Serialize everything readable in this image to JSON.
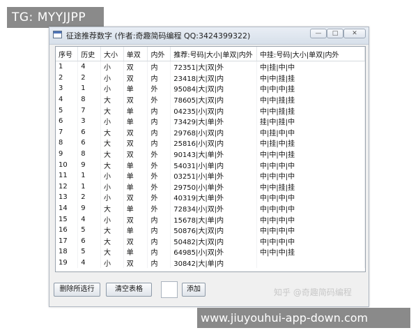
{
  "overlay": {
    "tg_label": "TG: MYYJJPP",
    "url_banner": "www.jiuyouhui-app-down.com",
    "zhihu_watermark": "知乎 @奇趣简码编程"
  },
  "window": {
    "title": "征途推荐数字 (作者:奇趣简码编程 QQ:3424399322)",
    "minimize_glyph": "—",
    "maximize_glyph": "□",
    "close_glyph": "✕"
  },
  "table": {
    "columns": [
      "序号",
      "历史",
      "大小",
      "单双",
      "内外",
      "推荐:号码|大小|单双|内外",
      "中挂:号码|大小|单双|内外"
    ],
    "rows": [
      [
        "1",
        "4",
        "小",
        "双",
        "内",
        "72351|大|双|外",
        "中|挂|中|中"
      ],
      [
        "2",
        "2",
        "小",
        "双",
        "内",
        "23418|大|双|内",
        "中|中|挂|挂"
      ],
      [
        "3",
        "1",
        "小",
        "单",
        "外",
        "95084|大|双|内",
        "中|中|中|挂"
      ],
      [
        "4",
        "8",
        "大",
        "双",
        "外",
        "78605|大|双|内",
        "中|中|挂|挂"
      ],
      [
        "5",
        "7",
        "大",
        "单",
        "内",
        "04235|小|双|内",
        "中|中|挂|挂"
      ],
      [
        "6",
        "3",
        "小",
        "单",
        "内",
        "73429|大|单|外",
        "挂|中|挂|中"
      ],
      [
        "7",
        "6",
        "大",
        "双",
        "内",
        "29768|小|双|内",
        "中|挂|中|中"
      ],
      [
        "8",
        "6",
        "大",
        "双",
        "内",
        "25816|小|双|内",
        "中|挂|中|挂"
      ],
      [
        "9",
        "8",
        "大",
        "双",
        "外",
        "90143|大|单|外",
        "中|中|中|挂"
      ],
      [
        "10",
        "9",
        "大",
        "单",
        "外",
        "54031|小|单|内",
        "中|中|中|中"
      ],
      [
        "11",
        "1",
        "小",
        "单",
        "外",
        "03251|小|单|外",
        "中|中|中|中"
      ],
      [
        "12",
        "1",
        "小",
        "单",
        "外",
        "29750|小|单|外",
        "中|中|挂|挂"
      ],
      [
        "13",
        "2",
        "小",
        "双",
        "外",
        "40319|大|单|外",
        "中|中|中|中"
      ],
      [
        "14",
        "9",
        "大",
        "单",
        "外",
        "72834|小|双|外",
        "中|中|中|中"
      ],
      [
        "15",
        "4",
        "小",
        "双",
        "内",
        "15678|大|单|内",
        "中|中|中|中"
      ],
      [
        "16",
        "5",
        "大",
        "单",
        "内",
        "50876|大|双|内",
        "中|中|中|中"
      ],
      [
        "17",
        "6",
        "大",
        "双",
        "内",
        "50482|大|双|内",
        "中|中|中|中"
      ],
      [
        "18",
        "5",
        "大",
        "单",
        "内",
        "64985|小|双|外",
        "中|中|中|挂"
      ],
      [
        "19",
        "4",
        "小",
        "双",
        "内",
        "30842|大|单|内",
        ""
      ]
    ]
  },
  "buttons": {
    "delete_selected": "删除所选行",
    "clear_table": "清空表格",
    "add": "添加"
  },
  "add_input": {
    "value": ""
  }
}
